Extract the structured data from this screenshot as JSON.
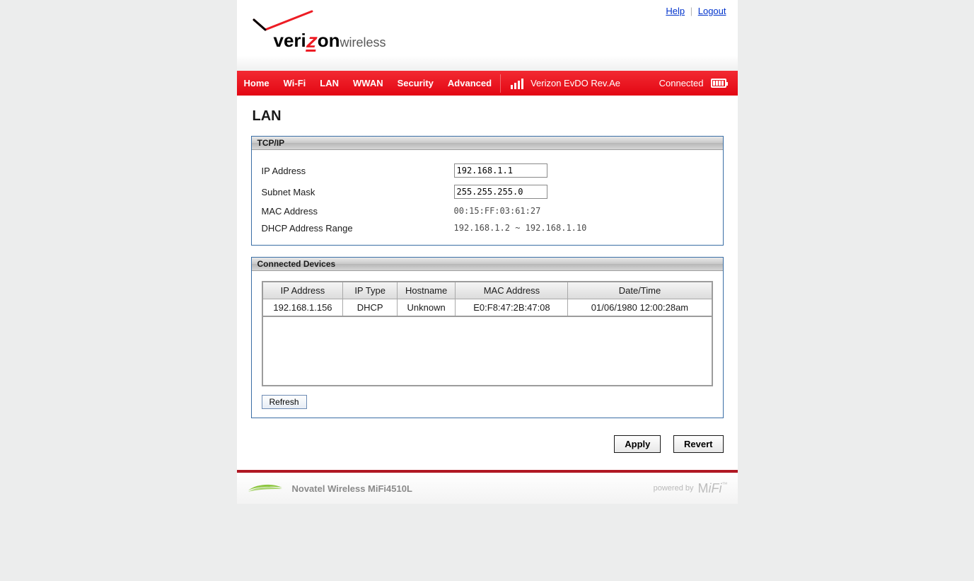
{
  "links": {
    "help": "Help",
    "logout": "Logout"
  },
  "logo": {
    "brand": "verizon",
    "sub": "wireless"
  },
  "nav": {
    "tabs": [
      "Home",
      "Wi-Fi",
      "LAN",
      "WWAN",
      "Security",
      "Advanced"
    ],
    "network": "Verizon  EvDO Rev.Ae",
    "status": "Connected"
  },
  "page": {
    "title": "LAN"
  },
  "tcpip": {
    "section_title": "TCP/IP",
    "labels": {
      "ip": "IP Address",
      "subnet": "Subnet Mask",
      "mac": "MAC Address",
      "dhcp_range": "DHCP Address Range"
    },
    "values": {
      "ip": "192.168.1.1",
      "subnet": "255.255.255.0",
      "mac": "00:15:FF:03:61:27",
      "dhcp_range": "192.168.1.2 ~ 192.168.1.10"
    }
  },
  "devices": {
    "section_title": "Connected Devices",
    "columns": [
      "IP Address",
      "IP Type",
      "Hostname",
      "MAC Address",
      "Date/Time"
    ],
    "rows": [
      {
        "ip": "192.168.1.156",
        "type": "DHCP",
        "host": "Unknown",
        "mac": "E0:F8:47:2B:47:08",
        "time": "01/06/1980 12:00:28am"
      }
    ],
    "refresh_label": "Refresh"
  },
  "actions": {
    "apply": "Apply",
    "revert": "Revert"
  },
  "footer": {
    "model": "Novatel Wireless MiFi4510L",
    "powered_by": "powered by",
    "mifi": "MiFi"
  }
}
